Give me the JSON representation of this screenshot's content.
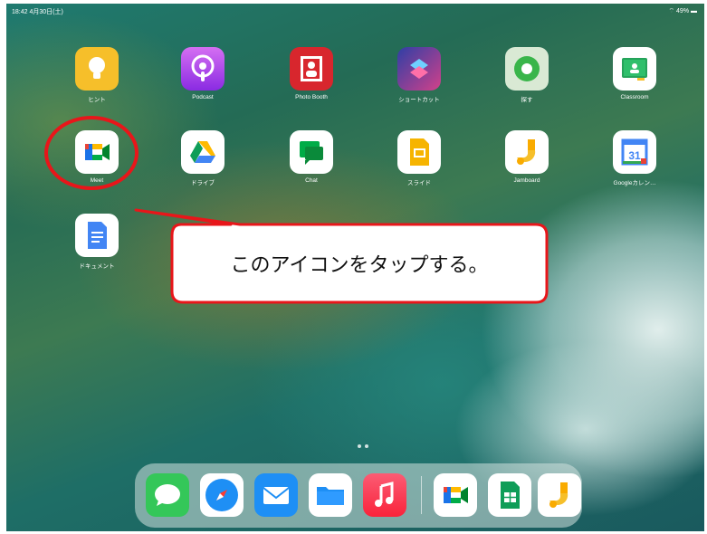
{
  "status_bar": {
    "time": "18:42  4月30日(土)",
    "right": "⌔ 49% ▬"
  },
  "apps_row1": [
    {
      "label": "ヒント",
      "icon": "lightbulb-icon"
    },
    {
      "label": "Podcast",
      "icon": "podcast-icon"
    },
    {
      "label": "Photo Booth",
      "icon": "photo-booth-icon"
    },
    {
      "label": "ショートカット",
      "icon": "shortcuts-icon"
    },
    {
      "label": "探す",
      "icon": "find-my-icon"
    },
    {
      "label": "Classroom",
      "icon": "classroom-icon"
    }
  ],
  "apps_row2": [
    {
      "label": "Meet",
      "icon": "google-meet-icon"
    },
    {
      "label": "ドライブ",
      "icon": "google-drive-icon"
    },
    {
      "label": "Chat",
      "icon": "google-chat-icon"
    },
    {
      "label": "スライド",
      "icon": "google-slides-icon"
    },
    {
      "label": "Jamboard",
      "icon": "jamboard-icon"
    },
    {
      "label": "Googleカレン…",
      "icon": "google-calendar-icon"
    }
  ],
  "apps_row3": [
    {
      "label": "ドキュメント",
      "icon": "google-docs-icon"
    }
  ],
  "callout": {
    "text": "このアイコンをタップする。",
    "border_color": "#e8161a"
  },
  "calendar_day": "31",
  "dock": [
    {
      "icon": "messages-icon"
    },
    {
      "icon": "safari-icon"
    },
    {
      "icon": "mail-icon"
    },
    {
      "icon": "files-icon"
    },
    {
      "icon": "music-icon"
    },
    {
      "icon": "google-meet-icon"
    },
    {
      "icon": "google-sheets-icon"
    },
    {
      "icon": "jamboard-icon"
    }
  ]
}
